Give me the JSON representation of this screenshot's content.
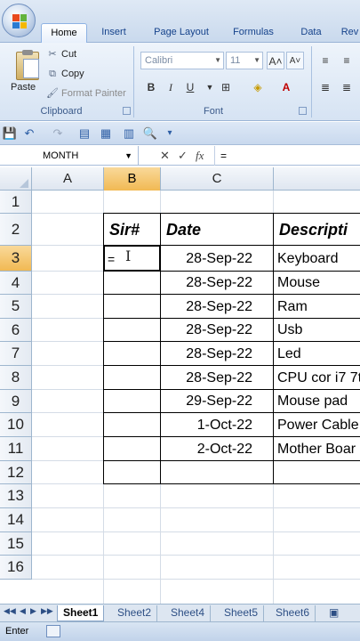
{
  "ribbon": {
    "tabs": [
      "Home",
      "Insert",
      "Page Layout",
      "Formulas",
      "Data",
      "Rev"
    ],
    "active_tab": "Home",
    "clipboard": {
      "paste": "Paste",
      "cut": "Cut",
      "copy": "Copy",
      "format_painter": "Format Painter",
      "label": "Clipboard"
    },
    "font": {
      "name": "Calibri",
      "size": "11",
      "grow": "A˄",
      "shrink": "A˅",
      "bold": "B",
      "italic": "I",
      "underline": "U",
      "label": "Font"
    }
  },
  "formula_bar": {
    "name_box": "MONTH",
    "cancel": "✕",
    "enter": "✓",
    "fx": "fx",
    "content": "="
  },
  "grid": {
    "columns": [
      "A",
      "B",
      "C"
    ],
    "rows": [
      "1",
      "2",
      "3",
      "4",
      "5",
      "6",
      "7",
      "8",
      "9",
      "10",
      "11",
      "12",
      "13",
      "14",
      "15",
      "16"
    ],
    "header": {
      "sr": "Sir#",
      "date": "Date",
      "desc": "Descripti"
    },
    "active_cell_content": "=",
    "entries": [
      {
        "date": "28-Sep-22",
        "desc": "Keyboard"
      },
      {
        "date": "28-Sep-22",
        "desc": "Mouse"
      },
      {
        "date": "28-Sep-22",
        "desc": "Ram"
      },
      {
        "date": "28-Sep-22",
        "desc": "Usb"
      },
      {
        "date": "28-Sep-22",
        "desc": "Led"
      },
      {
        "date": "28-Sep-22",
        "desc": "CPU cor i7 7t"
      },
      {
        "date": "29-Sep-22",
        "desc": "Mouse pad"
      },
      {
        "date": "1-Oct-22",
        "desc": "Power Cable"
      },
      {
        "date": "2-Oct-22",
        "desc": "Mother Boar"
      }
    ]
  },
  "sheets": [
    "Sheet1",
    "Sheet2",
    "Sheet4",
    "Sheet5",
    "Sheet6"
  ],
  "active_sheet": "Sheet1",
  "status": {
    "mode": "Enter"
  },
  "colors": {
    "selection_header": "#f1b953",
    "ribbon_text": "#15428b"
  }
}
